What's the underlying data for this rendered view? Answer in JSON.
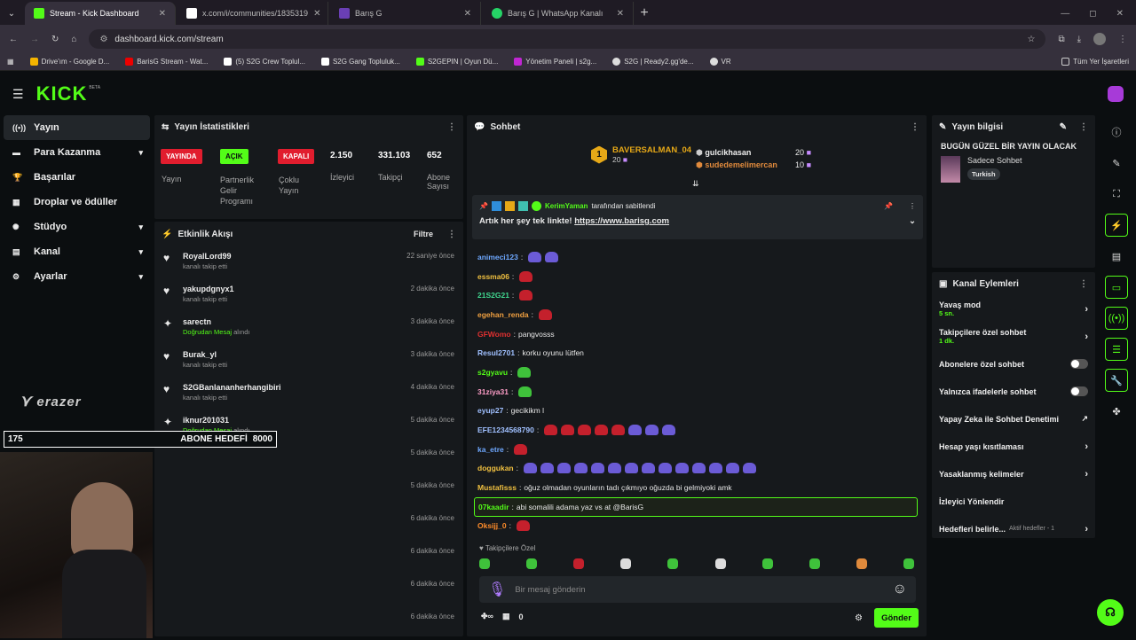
{
  "browser": {
    "tabs": [
      {
        "label": "Stream - Kick Dashboard",
        "color": "#53fc18"
      },
      {
        "label": "x.com/i/communities/1835319",
        "color": "#000000"
      },
      {
        "label": "Barış G",
        "color": "#6a3fb5"
      },
      {
        "label": "Barış G | WhatsApp Kanalı",
        "color": "#25d366"
      }
    ],
    "url": "dashboard.kick.com/stream",
    "bookmarks": [
      "Drive'ım - Google D...",
      "BarisG Stream - Wat...",
      "(5) S2G Crew Toplul...",
      "S2G Gang Topluluk...",
      "S2GEPIN | Oyun Dü...",
      "Yönetim Paneli | s2g...",
      "S2G | Ready2.gg'de...",
      "VR"
    ],
    "bookmarks_right": "Tüm Yer İşaretleri"
  },
  "app": {
    "logo": "KICK",
    "logo_beta": "BETA"
  },
  "nav": [
    {
      "label": "Yayın",
      "icon": "broadcast-icon",
      "chev": ""
    },
    {
      "label": "Para Kazanma",
      "icon": "money-icon",
      "chev": "▾"
    },
    {
      "label": "Başarılar",
      "icon": "trophy-icon",
      "chev": ""
    },
    {
      "label": "Droplar ve ödüller",
      "icon": "gift-icon",
      "chev": ""
    },
    {
      "label": "Stüdyo",
      "icon": "studio-icon",
      "chev": "▾"
    },
    {
      "label": "Kanal",
      "icon": "channel-icon",
      "chev": "▾"
    },
    {
      "label": "Ayarlar",
      "icon": "gear-icon",
      "chev": "▾"
    }
  ],
  "overlay": {
    "brand": "erazer",
    "goal_current": "175",
    "goal_label": "ABONE HEDEFİ",
    "goal_target": "8000"
  },
  "stats": {
    "title": "Yayın İstatistikleri",
    "live_badge": "YAYINDA",
    "live_label": "Yayın",
    "partner_badge": "AÇIK",
    "partner_label": "Partnerlik Gelir Programı",
    "multi_badge": "KAPALI",
    "multi_label": "Çoklu Yayın",
    "viewers": "2.150",
    "viewers_label": "İzleyici",
    "followers": "331.103",
    "followers_label": "Takipçi",
    "subs": "652",
    "subs_label": "Abone Sayısı"
  },
  "activity": {
    "title": "Etkinlik Akışı",
    "filter": "Filtre",
    "items": [
      {
        "name": "RoyalLord99",
        "sub": "kanalı takip etti",
        "time": "22 saniye önce",
        "icon": "♥"
      },
      {
        "name": "yakupdgnyx1",
        "sub": "kanalı takip etti",
        "time": "2 dakika önce",
        "icon": "♥"
      },
      {
        "name": "sarectn",
        "sub": "Doğrudan Mesaj",
        "sub2": "alındı",
        "time": "3 dakika önce",
        "icon": "✦"
      },
      {
        "name": "Burak_yl",
        "sub": "kanalı takip etti",
        "time": "3 dakika önce",
        "icon": "♥"
      },
      {
        "name": "S2GBanlananherhangibiri",
        "sub": "kanalı takip etti",
        "time": "4 dakika önce",
        "icon": "♥"
      },
      {
        "name": "iknur201031",
        "sub": "Doğrudan Mesaj",
        "sub2": "alındı",
        "time": "5 dakika önce",
        "icon": "✦"
      },
      {
        "name": "",
        "sub": "",
        "time": "5 dakika önce",
        "icon": ""
      },
      {
        "name": "",
        "sub": "",
        "time": "5 dakika önce",
        "icon": ""
      },
      {
        "name": "",
        "sub": "",
        "time": "6 dakika önce",
        "icon": ""
      },
      {
        "name": "",
        "sub": "",
        "time": "6 dakika önce",
        "icon": ""
      },
      {
        "name": "",
        "sub": "",
        "time": "6 dakika önce",
        "icon": ""
      },
      {
        "name": "",
        "sub": "",
        "time": "6 dakika önce",
        "icon": ""
      }
    ]
  },
  "chat": {
    "title": "Sohbet",
    "top_gifter": {
      "rank": "1",
      "name": "BAVERSALMAN_04",
      "count": "20"
    },
    "gifters": [
      {
        "name": "gulcikhasan",
        "count": "20"
      },
      {
        "name": "sudedemelimercan",
        "count": "10"
      }
    ],
    "pinned_by": "KerimYaman",
    "pinned_text": "tarafından sabitlendi",
    "pinned_msg": "Artık her şey tek linkte!",
    "pinned_link": "https://www.barisg.com",
    "messages": [
      {
        "user": "animeci123",
        "color": "#6ea8ff",
        "text": "",
        "emo": [
          "purple",
          "purple"
        ]
      },
      {
        "user": "essma06",
        "color": "#f0c040",
        "text": "",
        "emo": [
          "red"
        ]
      },
      {
        "user": "21S2G21",
        "color": "#40d890",
        "text": "",
        "emo": [
          "red"
        ]
      },
      {
        "user": "egehan_renda",
        "color": "#f0a040",
        "text": "",
        "emo": [
          "red"
        ]
      },
      {
        "user": "GFWomo",
        "color": "#e03030",
        "text": "pangvosss",
        "emo": []
      },
      {
        "user": "Resul2701",
        "color": "#a0c0ff",
        "text": "korku oyunu lütfen",
        "emo": []
      },
      {
        "user": "s2gyavu",
        "color": "#53fc18",
        "text": "",
        "emo": [
          "green"
        ]
      },
      {
        "user": "31ziya31",
        "color": "#ff9ec8",
        "text": "",
        "emo": [
          "green"
        ]
      },
      {
        "user": "eyup27",
        "color": "#a0c0ff",
        "text": "gecikikm l",
        "emo": []
      },
      {
        "user": "EFE1234568790",
        "color": "#a0c0ff",
        "text": "",
        "emo": [
          "red",
          "red",
          "red",
          "red",
          "red",
          "purple",
          "purple",
          "purple"
        ]
      },
      {
        "user": "ka_etre",
        "color": "#6ea8ff",
        "text": "",
        "emo": [
          "red"
        ]
      },
      {
        "user": "doggukan",
        "color": "#f0c040",
        "text": "",
        "emo": [
          "purple",
          "purple",
          "purple",
          "purple",
          "purple",
          "purple",
          "purple",
          "purple",
          "purple",
          "purple",
          "purple",
          "purple",
          "purple",
          "purple"
        ]
      },
      {
        "user": "Mustafisss",
        "color": "#f0c040",
        "text": "oğuz olmadan oyunların tadı çıkmıyo oğuzda bi gelmiyoki amk",
        "emo": []
      },
      {
        "user": "07kaadir",
        "color": "#53fc18",
        "text": "abi somalili adama yaz vs at @BarisG",
        "emo": [],
        "highlight": true
      },
      {
        "user": "Oksijj_0",
        "color": "#ff8c2a",
        "text": "",
        "emo": [
          "red"
        ]
      }
    ],
    "mode_label": "Takipçilere Özel",
    "input_placeholder": "Bir mesaj gönderin",
    "count": "0",
    "send": "Gönder"
  },
  "stream_info": {
    "title": "Yayın bilgisi",
    "stream_title": "BUGÜN GÜZEL BİR YAYIN OLACAK",
    "category": "Sadece Sohbet",
    "tag": "Turkish"
  },
  "channel_actions": {
    "title": "Kanal Eylemleri",
    "items": [
      {
        "label": "Yavaş mod",
        "sub": "5 sn.",
        "ctrl": "arrow"
      },
      {
        "label": "Takipçilere özel sohbet",
        "sub": "1 dk.",
        "ctrl": "arrow"
      },
      {
        "label": "Abonelere özel sohbet",
        "sub": "",
        "ctrl": "toggle"
      },
      {
        "label": "Yalnızca ifadelerle sohbet",
        "sub": "",
        "ctrl": "toggle"
      },
      {
        "label": "Yapay Zeka ile Sohbet Denetimi",
        "sub": "",
        "ctrl": "ext"
      },
      {
        "label": "Hesap yaşı kısıtlaması",
        "sub": "",
        "ctrl": "arrow"
      },
      {
        "label": "Yasaklanmış kelimeler",
        "sub": "",
        "ctrl": "arrow"
      },
      {
        "label": "İzleyici Yönlendir",
        "sub": "",
        "ctrl": ""
      },
      {
        "label": "Hedefleri belirle...",
        "sub": "",
        "ctrl": "arrow",
        "extra": "Aktif hedefler - 1"
      }
    ]
  }
}
